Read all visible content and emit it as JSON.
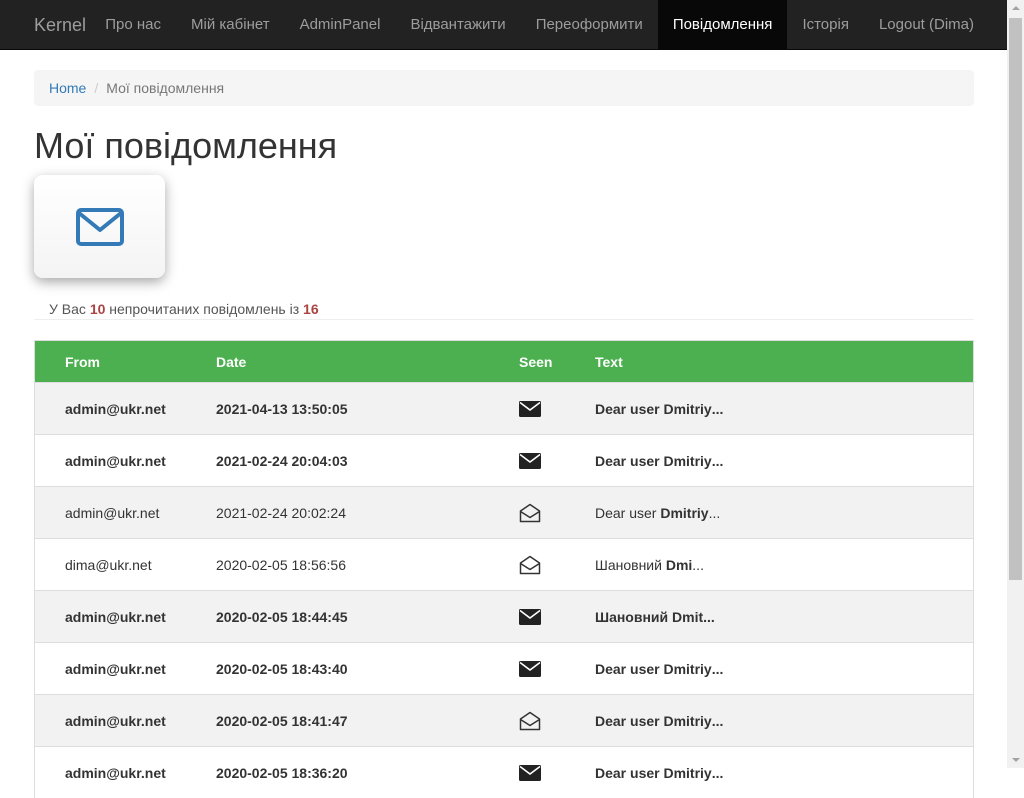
{
  "navbar": {
    "brand": "Kernel",
    "items": [
      {
        "label": "Про нас",
        "active": false
      },
      {
        "label": "Мій кабінет",
        "active": false
      },
      {
        "label": "AdminPanel",
        "active": false
      },
      {
        "label": "Відвантажити",
        "active": false
      },
      {
        "label": "Переоформити",
        "active": false
      },
      {
        "label": "Повідомлення",
        "active": true
      },
      {
        "label": "Історія",
        "active": false
      },
      {
        "label": "Logout (Dima)",
        "active": false
      }
    ]
  },
  "breadcrumb": {
    "home": "Home",
    "separator": "/",
    "current": "Мої повідомлення"
  },
  "page": {
    "title": "Мої повідомлення",
    "icon": "envelope-icon",
    "accent_color": "#337ab7"
  },
  "summary": {
    "prefix": "У Вас",
    "unread": "10",
    "middle": "непрочитаних повідомлень із",
    "total": "16"
  },
  "table": {
    "header_color": "#4cb050",
    "headers": {
      "from": "From",
      "date": "Date",
      "seen": "Seen",
      "text": "Text"
    },
    "rows": [
      {
        "from": "admin@ukr.net",
        "date": "2021-04-13 13:50:05",
        "seen": false,
        "seen_icon": "envelope-closed-icon",
        "text_prefix": "Dear user ",
        "text_name": "Dmitriy",
        "text_suffix": "...",
        "unread": true
      },
      {
        "from": "admin@ukr.net",
        "date": "2021-02-24 20:04:03",
        "seen": false,
        "seen_icon": "envelope-closed-icon",
        "text_prefix": "Dear user ",
        "text_name": "Dmitriy",
        "text_suffix": "...",
        "unread": true
      },
      {
        "from": "admin@ukr.net",
        "date": "2021-02-24 20:02:24",
        "seen": true,
        "seen_icon": "envelope-open-icon",
        "text_prefix": "Dear user ",
        "text_name": "Dmitriy",
        "text_suffix": "...",
        "unread": false
      },
      {
        "from": "dima@ukr.net",
        "date": "2020-02-05 18:56:56",
        "seen": true,
        "seen_icon": "envelope-open-icon",
        "text_prefix": "Шановний ",
        "text_name": "Dmi",
        "text_suffix": "...",
        "unread": false
      },
      {
        "from": "admin@ukr.net",
        "date": "2020-02-05 18:44:45",
        "seen": false,
        "seen_icon": "envelope-closed-icon",
        "text_prefix": "Шановний ",
        "text_name": "Dmit",
        "text_suffix": "...",
        "unread": true
      },
      {
        "from": "admin@ukr.net",
        "date": "2020-02-05 18:43:40",
        "seen": false,
        "seen_icon": "envelope-closed-icon",
        "text_prefix": "Dear user ",
        "text_name": "Dmitriy",
        "text_suffix": "...",
        "unread": true
      },
      {
        "from": "admin@ukr.net",
        "date": "2020-02-05 18:41:47",
        "seen": true,
        "seen_icon": "envelope-open-icon",
        "text_prefix": "Dear user ",
        "text_name": "Dmitriy",
        "text_suffix": "...",
        "unread": true
      },
      {
        "from": "admin@ukr.net",
        "date": "2020-02-05 18:36:20",
        "seen": false,
        "seen_icon": "envelope-closed-icon",
        "text_prefix": "Dear user ",
        "text_name": "Dmitriy",
        "text_suffix": "...",
        "unread": true
      }
    ]
  }
}
